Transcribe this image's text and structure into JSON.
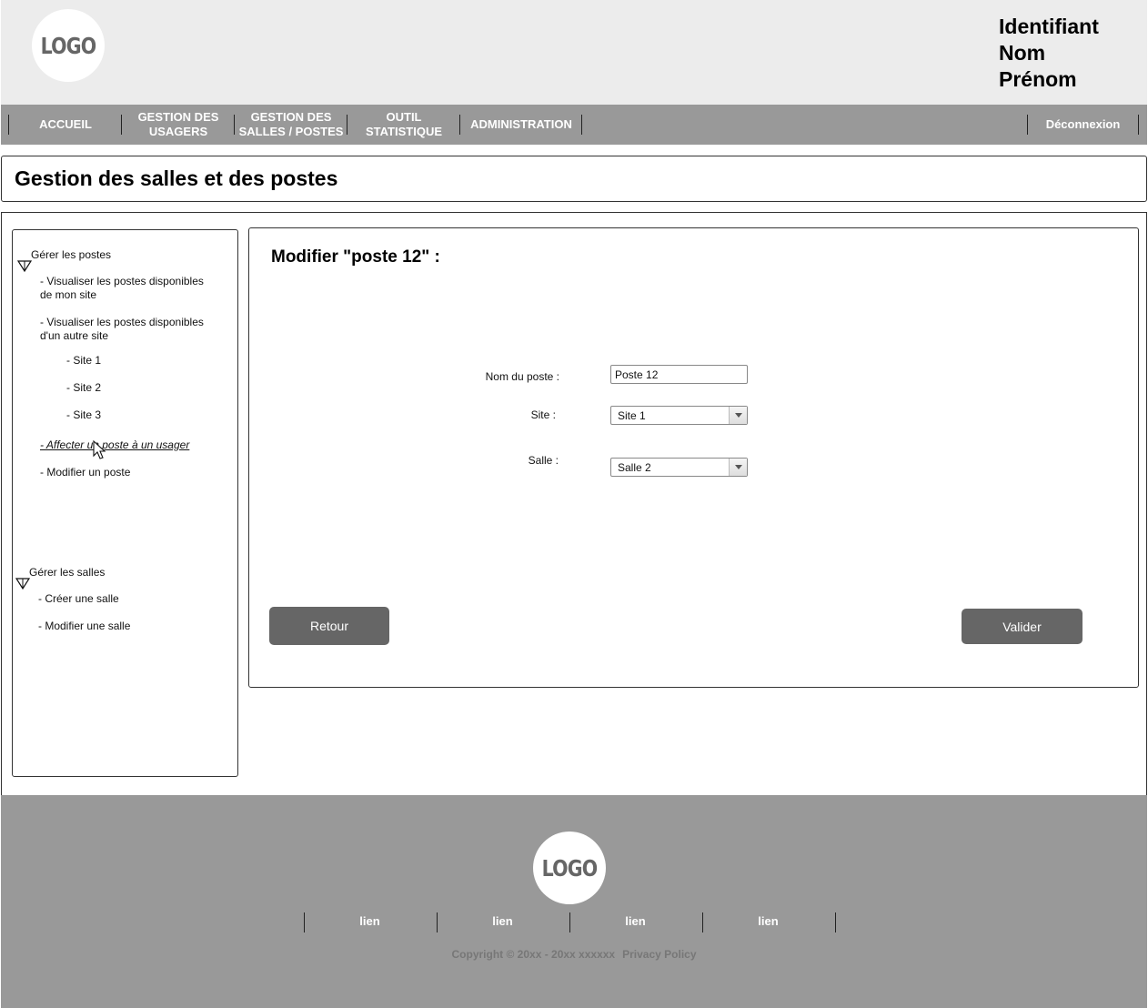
{
  "header": {
    "logo": "LOGO",
    "user": {
      "line1": "Identifiant",
      "line2": "Nom",
      "line3": "Prénom"
    }
  },
  "nav": {
    "items": [
      {
        "label": "ACCUEIL"
      },
      {
        "label": "GESTION DES\nUSAGERS"
      },
      {
        "label": "GESTION DES\nSALLES / POSTES"
      },
      {
        "label": "OUTIL\nSTATISTIQUE"
      },
      {
        "label": "ADMINISTRATION"
      }
    ],
    "logout": "Déconnexion"
  },
  "page": {
    "title": "Gestion des salles et des postes"
  },
  "sidebar": {
    "postes": {
      "heading": "Gérer les postes",
      "items": [
        {
          "label": "- Visualiser les postes disponibles\nde mon site"
        },
        {
          "label": "- Visualiser les postes disponibles\nd'un autre site"
        },
        {
          "label": "- Site 1"
        },
        {
          "label": "- Site 2"
        },
        {
          "label": "- Site 3"
        },
        {
          "label": "- Affecter un poste à un usager"
        },
        {
          "label": "- Modifier un poste"
        }
      ]
    },
    "salles": {
      "heading": "Gérer les salles",
      "items": [
        {
          "label": "- Créer une salle"
        },
        {
          "label": "- Modifier une salle"
        }
      ]
    }
  },
  "form": {
    "title": "Modifier \"poste 12\" :",
    "nom_label": "Nom du poste :",
    "nom_value": "Poste 12",
    "site_label": "Site :",
    "site_value": "Site 1",
    "salle_label": "Salle :",
    "salle_value": "Salle 2",
    "back_button": "Retour",
    "submit_button": "Valider"
  },
  "footer": {
    "logo": "LOGO",
    "links": [
      "lien",
      "lien",
      "lien",
      "lien"
    ],
    "copyright": "Copyright © 20xx - 20xx xxxxxx",
    "privacy": "Privacy Policy"
  },
  "colors": {
    "header_bg": "#ececec",
    "nav_bg": "#999999",
    "button_bg": "#666666",
    "footer_bg": "#999999"
  }
}
